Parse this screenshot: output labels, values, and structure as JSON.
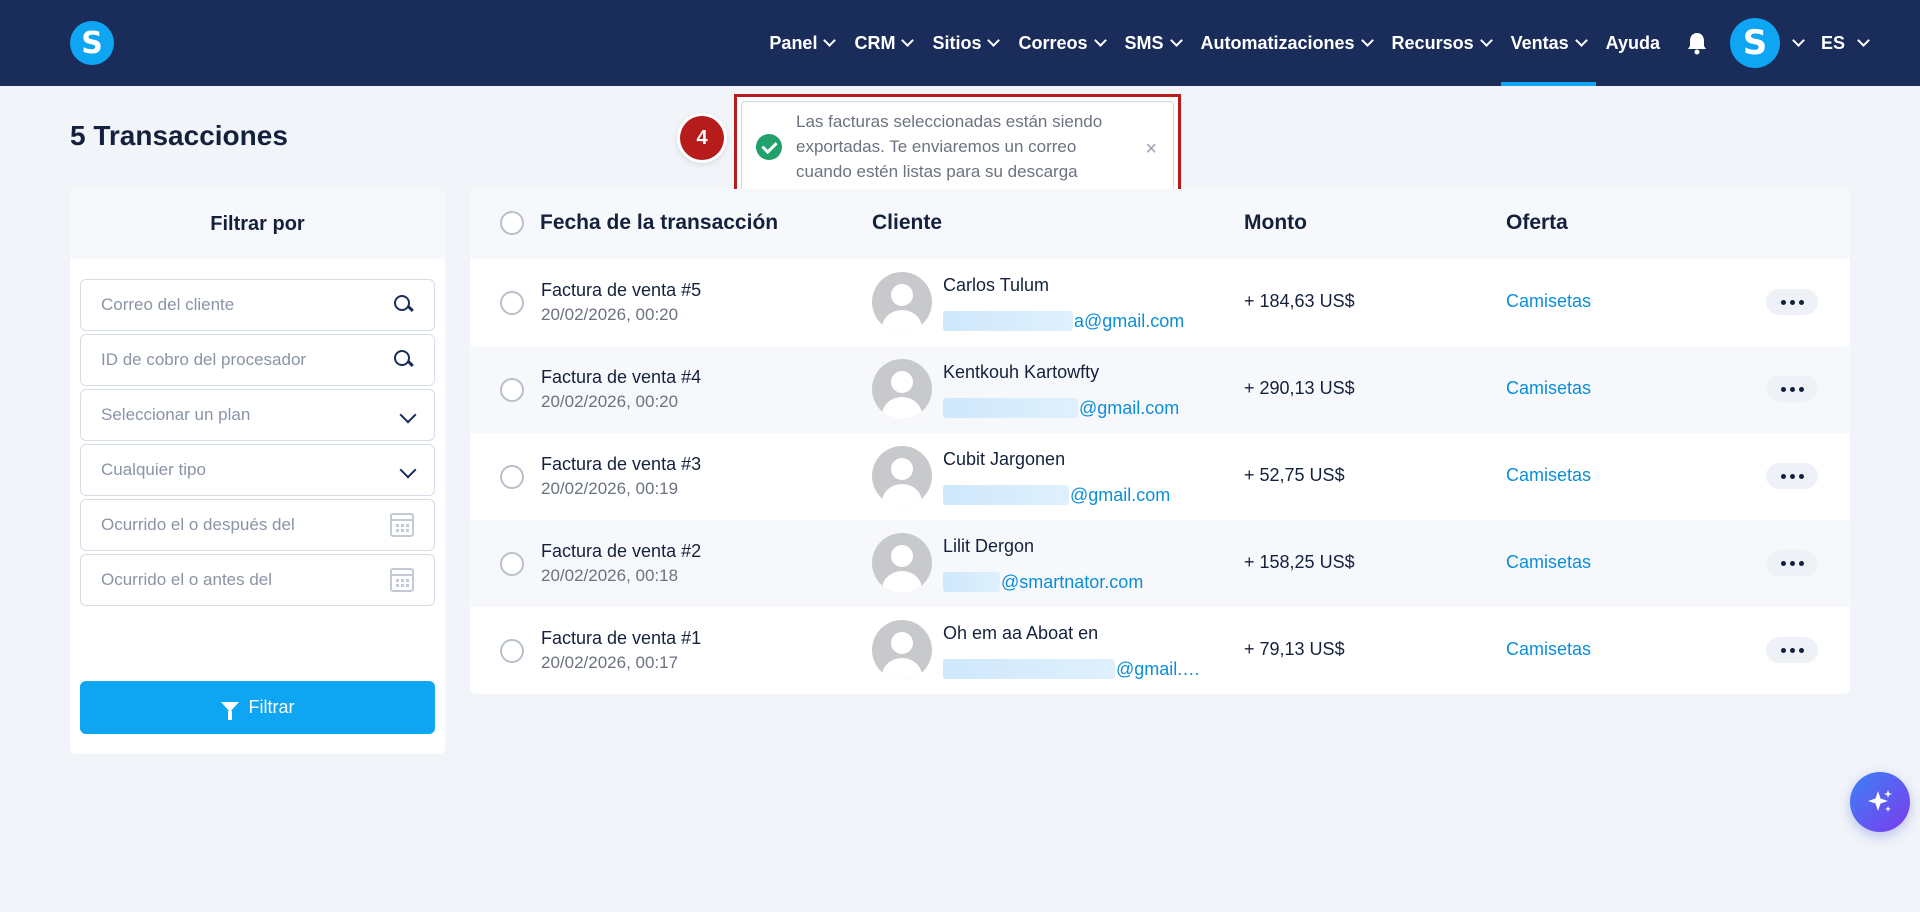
{
  "nav": {
    "logo_letter": "S",
    "items": [
      {
        "label": "Panel",
        "has_dropdown": true,
        "active": false
      },
      {
        "label": "CRM",
        "has_dropdown": true,
        "active": false
      },
      {
        "label": "Sitios",
        "has_dropdown": true,
        "active": false
      },
      {
        "label": "Correos",
        "has_dropdown": true,
        "active": false
      },
      {
        "label": "SMS",
        "has_dropdown": true,
        "active": false
      },
      {
        "label": "Automatizaciones",
        "has_dropdown": true,
        "active": false
      },
      {
        "label": "Recursos",
        "has_dropdown": true,
        "active": false
      },
      {
        "label": "Ventas",
        "has_dropdown": true,
        "active": true
      },
      {
        "label": "Ayuda",
        "has_dropdown": false,
        "active": false
      }
    ],
    "avatar_letter": "S",
    "language": "ES",
    "icons": [
      "bell-icon",
      "chevron-down-icon"
    ]
  },
  "page": {
    "title": "5 Transacciones"
  },
  "toast": {
    "step_number": "4",
    "message": "Las facturas seleccionadas están siendo exportadas. Te enviaremos un correo cuando estén listas para su descarga",
    "close_symbol": "×"
  },
  "filters": {
    "heading": "Filtrar por",
    "customer_email_placeholder": "Correo del cliente",
    "processor_id_placeholder": "ID de cobro del procesador",
    "plan_placeholder": "Seleccionar un plan",
    "type_placeholder": "Cualquier tipo",
    "after_date_placeholder": "Ocurrido el o después del",
    "before_date_placeholder": "Ocurrido el o antes del",
    "button_label": "Filtrar"
  },
  "table": {
    "headers": {
      "date": "Fecha de la transacción",
      "customer": "Cliente",
      "amount": "Monto",
      "offer": "Oferta"
    },
    "rows": [
      {
        "title": "Factura de venta #5",
        "date": "20/02/2026, 00:20",
        "name": "Carlos Tulum",
        "email_visible": "a@gmail.com",
        "amount": "+ 184,63 US$",
        "offer": "Camisetas"
      },
      {
        "title": "Factura de venta #4",
        "date": "20/02/2026, 00:20",
        "name": "Kentkouh Kartowfty",
        "email_visible": "@gmail.com",
        "amount": "+ 290,13 US$",
        "offer": "Camisetas"
      },
      {
        "title": "Factura de venta #3",
        "date": "20/02/2026, 00:19",
        "name": "Cubit Jargonen",
        "email_visible": "@gmail.com",
        "amount": "+ 52,75 US$",
        "offer": "Camisetas"
      },
      {
        "title": "Factura de venta #2",
        "date": "20/02/2026, 00:18",
        "name": "Lilit Dergon",
        "email_visible": "@smartnator.com",
        "amount": "+ 158,25 US$",
        "offer": "Camisetas"
      },
      {
        "title": "Factura de venta #1",
        "date": "20/02/2026, 00:17",
        "name": "Oh em aa Aboat en",
        "email_visible": "@gmail.…",
        "amount": "+ 79,13 US$",
        "offer": "Camisetas"
      }
    ]
  },
  "colors": {
    "nav_bg": "#1a2d5a",
    "accent": "#0ea5f2",
    "link": "#0b8ed8",
    "highlight": "#b71c1c",
    "success": "#22a06b"
  }
}
